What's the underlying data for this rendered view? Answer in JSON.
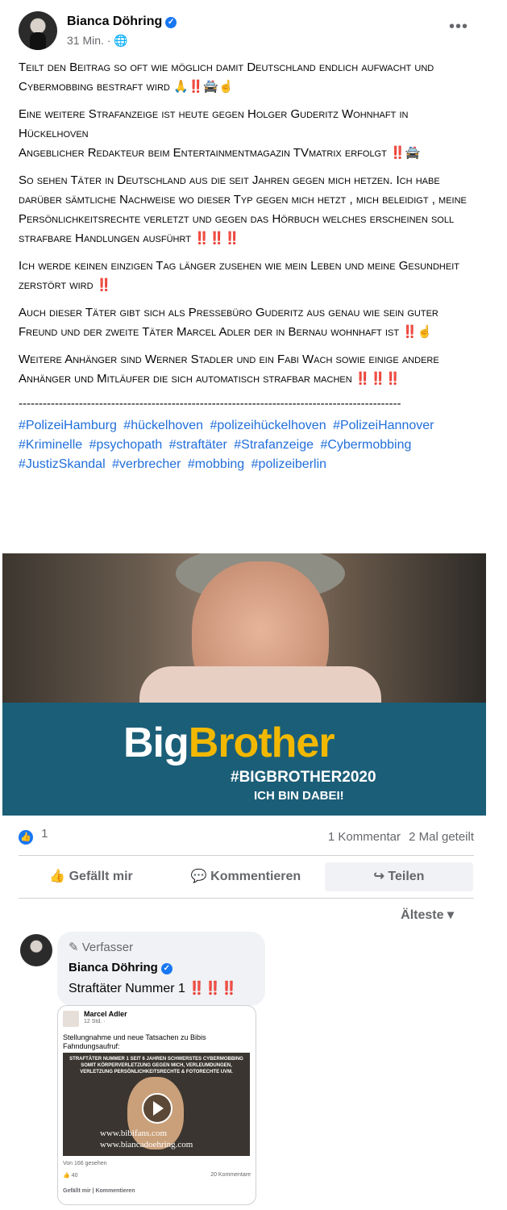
{
  "post": {
    "author": "Bianca Döhring",
    "time": "31 Min. ·",
    "more_label": "•••",
    "paragraphs": [
      "Teilt den Beitrag so oft wie möglich damit Deutschland endlich aufwacht und Cybermobbing bestraft wird 🙏‼️🚔☝️",
      "Eine weitere Strafanzeige ist heute gegen Holger Guderitz Wohnhaft in Hückelhoven",
      "Angeblicher Redakteur beim Entertainmentmagazin TVmatrix erfolgt ‼️🚔",
      "So sehen Täter in Deutschland aus die seit Jahren gegen mich hetzen. Ich habe darüber sämtliche Nachweise wo dieser Typ gegen mich hetzt , mich beleidigt , meine Persönlichkeitsrechte verletzt und gegen das Hörbuch welches erscheinen soll strafbare Handlungen ausführt ‼️‼️‼️",
      "Ich werde keinen einzigen Tag länger zusehen wie mein Leben und meine Gesundheit zerstört wird ‼️",
      "Auch dieser Täter gibt sich als Pressebüro Guderitz aus genau wie sein guter Freund und der zweite Täter Marcel Adler der in Bernau wohnhaft ist ‼️☝️",
      "Weitere Anhänger sind Werner Stadler und ein Fabi Wach sowie einige andere Anhänger und Mitläufer die sich automatisch strafbar machen ‼️‼️‼️"
    ],
    "separator": "-----------------------------------------------------------------------------------------------",
    "hashtags": [
      "#PolizeiHamburg",
      "#hückelhoven",
      "#polizeihückelhoven",
      "#PolizeiHannover",
      "#Kriminelle",
      "#psychopath",
      "#straftäter",
      "#Strafanzeige",
      "#Cybermobbing",
      "#JustizSkandal",
      "#verbrecher",
      "#mobbing",
      "#polizeiberlin"
    ]
  },
  "image": {
    "brand_big": "Big",
    "brand_brother": "Brother",
    "tag": "#BIGBROTHER2020",
    "sub": "ICH BIN DABEI!"
  },
  "stats": {
    "likes": "1",
    "comments": "1 Kommentar",
    "shares": "2 Mal geteilt"
  },
  "actions": {
    "like": "Gefällt mir",
    "comment": "Kommentieren",
    "share": "Teilen"
  },
  "sort_label": "Älteste",
  "comment": {
    "author_tag": "Verfasser",
    "author": "Bianca Döhring",
    "text": "Straftäter Nummer 1 ‼️‼️‼️"
  },
  "attachment": {
    "name": "Marcel Adler",
    "time": "12 Std. ·",
    "text": "Stellungnahme und neue Tatsachen zu Bibis Fahndungsaufruf:",
    "video_caption": "STRAFTÄTER NUMMER 1 SEIT 6 JAHREN SCHWERSTES CYBERMOBBING SOMIT KÖRPERVERLETZUNG GEGEN MICH, VERLEUMDUNGEN, VERLETZUNG PERSÖNLICHKEITSRECHTE & FOTORECHTE UVM.",
    "url1": "www.bibifans.com",
    "url2": "www.biancadoehring.com",
    "views": "Von 166 gesehen",
    "likes": "40",
    "comments": "20 Kommentare",
    "actions": "Gefällt mir | Kommentieren"
  },
  "colors": {
    "accent": "#1877f2",
    "hashtag": "#216fdb",
    "band": "#1b5e78"
  }
}
